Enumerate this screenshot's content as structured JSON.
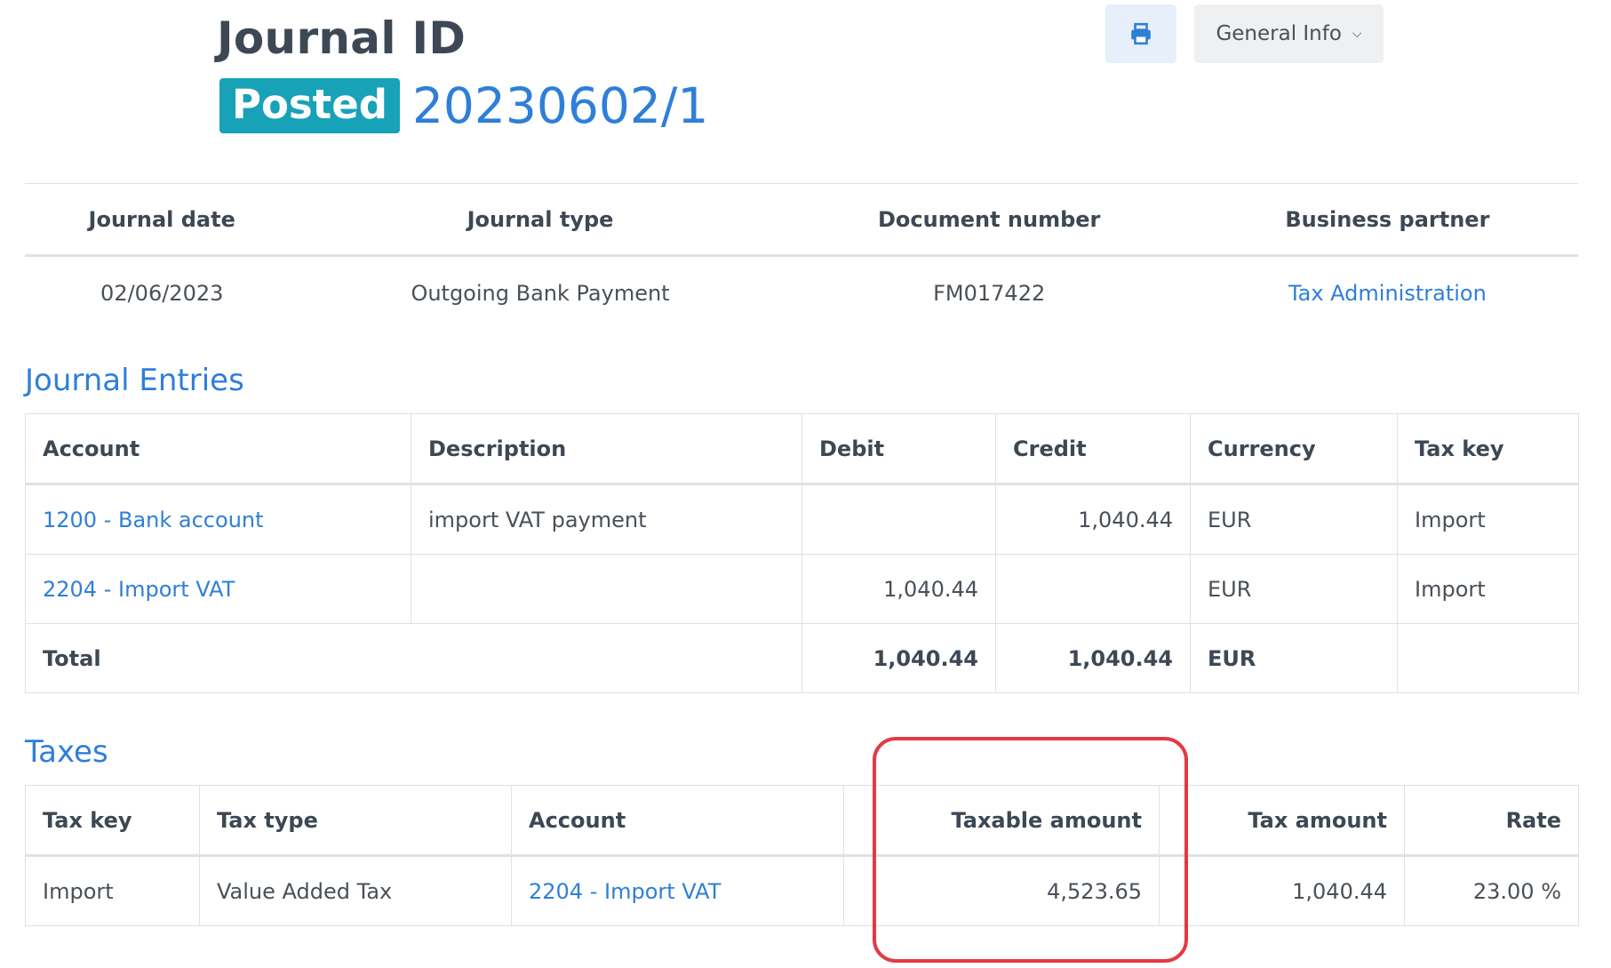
{
  "header": {
    "title": "Journal ID",
    "status": "Posted",
    "journal_id": "20230602/1",
    "general_info_label": "General Info"
  },
  "info": {
    "headers": [
      "Journal date",
      "Journal type",
      "Document number",
      "Business partner"
    ],
    "values": [
      "02/06/2023",
      "Outgoing Bank Payment",
      "FM017422",
      "Tax Administration"
    ]
  },
  "journal_entries": {
    "title": "Journal Entries",
    "headers": [
      "Account",
      "Description",
      "Debit",
      "Credit",
      "Currency",
      "Tax key"
    ],
    "rows": [
      [
        "1200 - Bank account",
        "import VAT payment",
        "",
        "1,040.44",
        "EUR",
        "Import"
      ],
      [
        "2204 - Import VAT",
        "",
        "1,040.44",
        "",
        "EUR",
        "Import"
      ]
    ],
    "total": {
      "label": "Total",
      "debit": "1,040.44",
      "credit": "1,040.44",
      "currency": "EUR"
    }
  },
  "taxes": {
    "title": "Taxes",
    "headers": [
      "Tax key",
      "Tax type",
      "Account",
      "Taxable amount",
      "Tax amount",
      "Rate"
    ],
    "rows": [
      [
        "Import",
        "Value Added Tax",
        "2204 - Import VAT",
        "4,523.65",
        "1,040.44",
        "23.00 %"
      ]
    ]
  },
  "colors": {
    "accent": "#2f7fd8",
    "badge": "#17a2b8",
    "highlight": "#e23a44"
  }
}
